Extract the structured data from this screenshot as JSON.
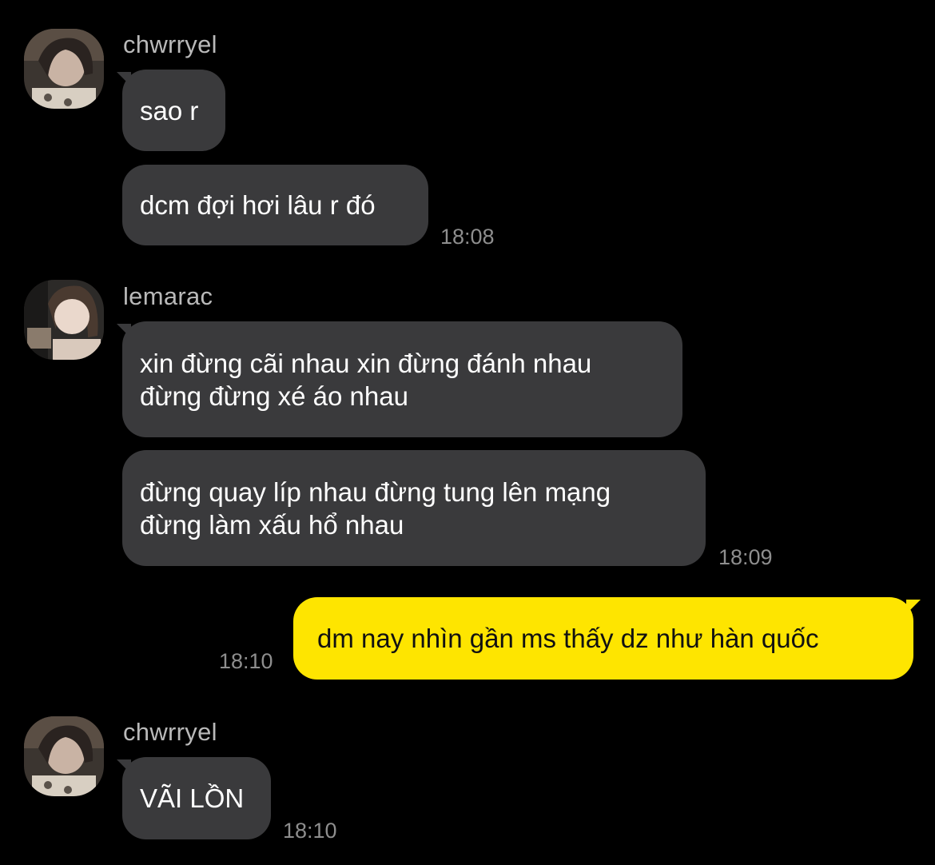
{
  "theme": {
    "background": "#000000",
    "incoming_bubble": "#3a3a3c",
    "outgoing_bubble": "#fee500",
    "sender_name_color": "#b9b9b9",
    "time_color": "#8e8e8e"
  },
  "messages": [
    {
      "sender": "chwrryel",
      "avatar": "profile-photo",
      "bubbles": [
        "sao r",
        "dcm đợi hơi lâu r đó"
      ],
      "time": "18:08"
    },
    {
      "sender": "lemarac",
      "avatar": "profile-photo",
      "bubbles": [
        "xin đừng cãi nhau xin đừng đánh nhau\nđừng đừng xé áo nhau",
        "đừng quay líp nhau đừng tung lên mạng\nđừng làm xấu hổ nhau"
      ],
      "time": "18:09"
    },
    {
      "sender": "me",
      "bubbles": [
        "dm nay nhìn gần ms thấy dz như hàn quốc"
      ],
      "time": "18:10"
    },
    {
      "sender": "chwrryel",
      "avatar": "profile-photo",
      "bubbles": [
        "VÃI LỒN"
      ],
      "time": "18:10"
    }
  ]
}
